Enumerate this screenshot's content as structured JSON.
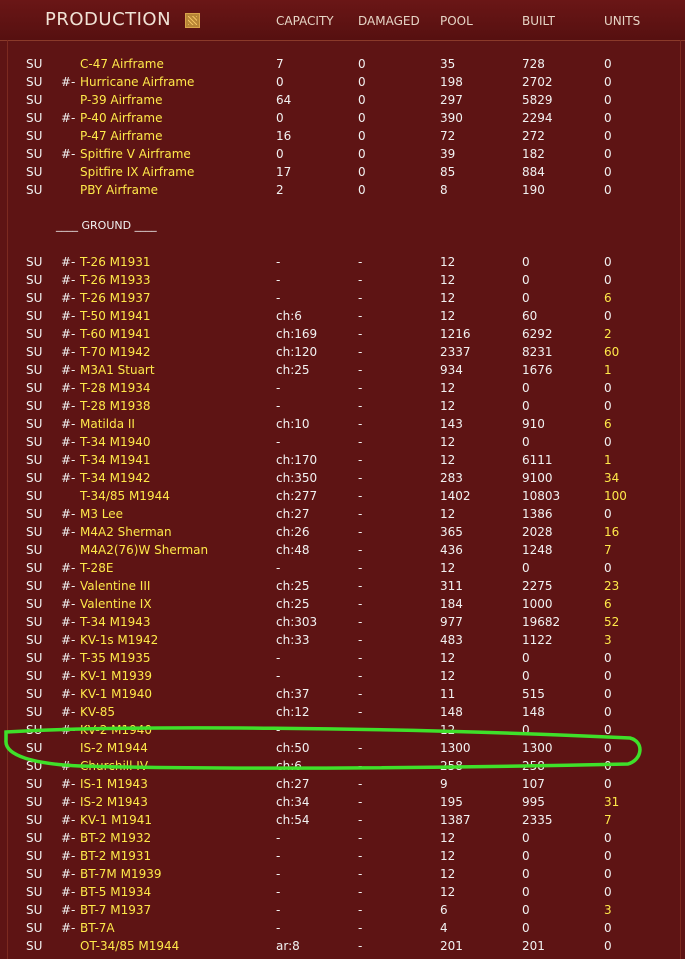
{
  "header": {
    "title": "PRODUCTION",
    "icon": "production-graph-icon",
    "columns": [
      "CAPACITY",
      "DAMAGED",
      "POOL",
      "BUILT",
      "UNITS"
    ]
  },
  "air_rows": [
    {
      "nation": "SU",
      "mark": "",
      "name": "C-47 Airframe",
      "capacity": "7",
      "damaged": "0",
      "pool": "35",
      "built": "728",
      "units": "0"
    },
    {
      "nation": "SU",
      "mark": "#-",
      "name": "Hurricane Airframe",
      "capacity": "0",
      "damaged": "0",
      "pool": "198",
      "built": "2702",
      "units": "0"
    },
    {
      "nation": "SU",
      "mark": "",
      "name": "P-39 Airframe",
      "capacity": "64",
      "damaged": "0",
      "pool": "297",
      "built": "5829",
      "units": "0"
    },
    {
      "nation": "SU",
      "mark": "#-",
      "name": "P-40 Airframe",
      "capacity": "0",
      "damaged": "0",
      "pool": "390",
      "built": "2294",
      "units": "0"
    },
    {
      "nation": "SU",
      "mark": "",
      "name": "P-47 Airframe",
      "capacity": "16",
      "damaged": "0",
      "pool": "72",
      "built": "272",
      "units": "0"
    },
    {
      "nation": "SU",
      "mark": "#-",
      "name": "Spitfire V Airframe",
      "capacity": "0",
      "damaged": "0",
      "pool": "39",
      "built": "182",
      "units": "0"
    },
    {
      "nation": "SU",
      "mark": "",
      "name": "Spitfire IX Airframe",
      "capacity": "17",
      "damaged": "0",
      "pool": "85",
      "built": "884",
      "units": "0"
    },
    {
      "nation": "SU",
      "mark": "",
      "name": "PBY Airframe",
      "capacity": "2",
      "damaged": "0",
      "pool": "8",
      "built": "190",
      "units": "0"
    }
  ],
  "ground_section_label": "____ GROUND ____",
  "ground_rows": [
    {
      "nation": "SU",
      "mark": "#-",
      "name": "T-26 M1931",
      "capacity": "-",
      "damaged": "-",
      "pool": "12",
      "built": "0",
      "units": "0"
    },
    {
      "nation": "SU",
      "mark": "#-",
      "name": "T-26 M1933",
      "capacity": "-",
      "damaged": "-",
      "pool": "12",
      "built": "0",
      "units": "0"
    },
    {
      "nation": "SU",
      "mark": "#-",
      "name": "T-26 M1937",
      "capacity": "-",
      "damaged": "-",
      "pool": "12",
      "built": "0",
      "units": "6"
    },
    {
      "nation": "SU",
      "mark": "#-",
      "name": "T-50 M1941",
      "capacity": "ch:6",
      "damaged": "-",
      "pool": "12",
      "built": "60",
      "units": "0"
    },
    {
      "nation": "SU",
      "mark": "#-",
      "name": "T-60 M1941",
      "capacity": "ch:169",
      "damaged": "-",
      "pool": "1216",
      "built": "6292",
      "units": "2"
    },
    {
      "nation": "SU",
      "mark": "#-",
      "name": "T-70 M1942",
      "capacity": "ch:120",
      "damaged": "-",
      "pool": "2337",
      "built": "8231",
      "units": "60"
    },
    {
      "nation": "SU",
      "mark": "#-",
      "name": "M3A1 Stuart",
      "capacity": "ch:25",
      "damaged": "-",
      "pool": "934",
      "built": "1676",
      "units": "1"
    },
    {
      "nation": "SU",
      "mark": "#-",
      "name": "T-28 M1934",
      "capacity": "-",
      "damaged": "-",
      "pool": "12",
      "built": "0",
      "units": "0"
    },
    {
      "nation": "SU",
      "mark": "#-",
      "name": "T-28 M1938",
      "capacity": "-",
      "damaged": "-",
      "pool": "12",
      "built": "0",
      "units": "0"
    },
    {
      "nation": "SU",
      "mark": "#-",
      "name": "Matilda II",
      "capacity": "ch:10",
      "damaged": "-",
      "pool": "143",
      "built": "910",
      "units": "6"
    },
    {
      "nation": "SU",
      "mark": "#-",
      "name": "T-34 M1940",
      "capacity": "-",
      "damaged": "-",
      "pool": "12",
      "built": "0",
      "units": "0"
    },
    {
      "nation": "SU",
      "mark": "#-",
      "name": "T-34 M1941",
      "capacity": "ch:170",
      "damaged": "-",
      "pool": "12",
      "built": "6111",
      "units": "1"
    },
    {
      "nation": "SU",
      "mark": "#-",
      "name": "T-34 M1942",
      "capacity": "ch:350",
      "damaged": "-",
      "pool": "283",
      "built": "9100",
      "units": "34"
    },
    {
      "nation": "SU",
      "mark": "",
      "name": "T-34/85 M1944",
      "capacity": "ch:277",
      "damaged": "-",
      "pool": "1402",
      "built": "10803",
      "units": "100"
    },
    {
      "nation": "SU",
      "mark": "#-",
      "name": "M3 Lee",
      "capacity": "ch:27",
      "damaged": "-",
      "pool": "12",
      "built": "1386",
      "units": "0"
    },
    {
      "nation": "SU",
      "mark": "#-",
      "name": "M4A2 Sherman",
      "capacity": "ch:26",
      "damaged": "-",
      "pool": "365",
      "built": "2028",
      "units": "16"
    },
    {
      "nation": "SU",
      "mark": "",
      "name": "M4A2(76)W Sherman",
      "capacity": "ch:48",
      "damaged": "-",
      "pool": "436",
      "built": "1248",
      "units": "7"
    },
    {
      "nation": "SU",
      "mark": "#-",
      "name": "T-28E",
      "capacity": "-",
      "damaged": "-",
      "pool": "12",
      "built": "0",
      "units": "0"
    },
    {
      "nation": "SU",
      "mark": "#-",
      "name": "Valentine III",
      "capacity": "ch:25",
      "damaged": "-",
      "pool": "311",
      "built": "2275",
      "units": "23"
    },
    {
      "nation": "SU",
      "mark": "#-",
      "name": "Valentine IX",
      "capacity": "ch:25",
      "damaged": "-",
      "pool": "184",
      "built": "1000",
      "units": "6"
    },
    {
      "nation": "SU",
      "mark": "#-",
      "name": "T-34 M1943",
      "capacity": "ch:303",
      "damaged": "-",
      "pool": "977",
      "built": "19682",
      "units": "52"
    },
    {
      "nation": "SU",
      "mark": "#-",
      "name": "KV-1s M1942",
      "capacity": "ch:33",
      "damaged": "-",
      "pool": "483",
      "built": "1122",
      "units": "3"
    },
    {
      "nation": "SU",
      "mark": "#-",
      "name": "T-35 M1935",
      "capacity": "-",
      "damaged": "-",
      "pool": "12",
      "built": "0",
      "units": "0"
    },
    {
      "nation": "SU",
      "mark": "#-",
      "name": "KV-1 M1939",
      "capacity": "-",
      "damaged": "-",
      "pool": "12",
      "built": "0",
      "units": "0"
    },
    {
      "nation": "SU",
      "mark": "#-",
      "name": "KV-1 M1940",
      "capacity": "ch:37",
      "damaged": "-",
      "pool": "11",
      "built": "515",
      "units": "0"
    },
    {
      "nation": "SU",
      "mark": "#-",
      "name": "KV-85",
      "capacity": "ch:12",
      "damaged": "-",
      "pool": "148",
      "built": "148",
      "units": "0"
    },
    {
      "nation": "SU",
      "mark": "#-",
      "name": "KV-2 M1940",
      "capacity": "-",
      "damaged": "-",
      "pool": "12",
      "built": "0",
      "units": "0"
    },
    {
      "nation": "SU",
      "mark": "",
      "name": "IS-2 M1944",
      "capacity": "ch:50",
      "damaged": "-",
      "pool": "1300",
      "built": "1300",
      "units": "0"
    },
    {
      "nation": "SU",
      "mark": "#-",
      "name": "Churchill IV",
      "capacity": "ch:6",
      "damaged": "-",
      "pool": "258",
      "built": "258",
      "units": "0"
    },
    {
      "nation": "SU",
      "mark": "#-",
      "name": "IS-1 M1943",
      "capacity": "ch:27",
      "damaged": "-",
      "pool": "9",
      "built": "107",
      "units": "0"
    },
    {
      "nation": "SU",
      "mark": "#-",
      "name": "IS-2 M1943",
      "capacity": "ch:34",
      "damaged": "-",
      "pool": "195",
      "built": "995",
      "units": "31"
    },
    {
      "nation": "SU",
      "mark": "#-",
      "name": "KV-1 M1941",
      "capacity": "ch:54",
      "damaged": "-",
      "pool": "1387",
      "built": "2335",
      "units": "7"
    },
    {
      "nation": "SU",
      "mark": "#-",
      "name": "BT-2 M1932",
      "capacity": "-",
      "damaged": "-",
      "pool": "12",
      "built": "0",
      "units": "0"
    },
    {
      "nation": "SU",
      "mark": "#-",
      "name": "BT-2 M1931",
      "capacity": "-",
      "damaged": "-",
      "pool": "12",
      "built": "0",
      "units": "0"
    },
    {
      "nation": "SU",
      "mark": "#-",
      "name": "BT-7M M1939",
      "capacity": "-",
      "damaged": "-",
      "pool": "12",
      "built": "0",
      "units": "0"
    },
    {
      "nation": "SU",
      "mark": "#-",
      "name": "BT-5 M1934",
      "capacity": "-",
      "damaged": "-",
      "pool": "12",
      "built": "0",
      "units": "0"
    },
    {
      "nation": "SU",
      "mark": "#-",
      "name": "BT-7 M1937",
      "capacity": "-",
      "damaged": "-",
      "pool": "6",
      "built": "0",
      "units": "3"
    },
    {
      "nation": "SU",
      "mark": "#-",
      "name": "BT-7A",
      "capacity": "-",
      "damaged": "-",
      "pool": "4",
      "built": "0",
      "units": "0"
    },
    {
      "nation": "SU",
      "mark": "",
      "name": "OT-34/85 M1944",
      "capacity": "ar:8",
      "damaged": "-",
      "pool": "201",
      "built": "201",
      "units": "0"
    }
  ],
  "highlight": {
    "row_name": "IS-2 M1944",
    "color": "#3fe02a"
  },
  "colors": {
    "background": "#5e1414",
    "text": "#f2f2f2",
    "name_text": "#ffe94a",
    "highlight": "#3fe02a"
  }
}
